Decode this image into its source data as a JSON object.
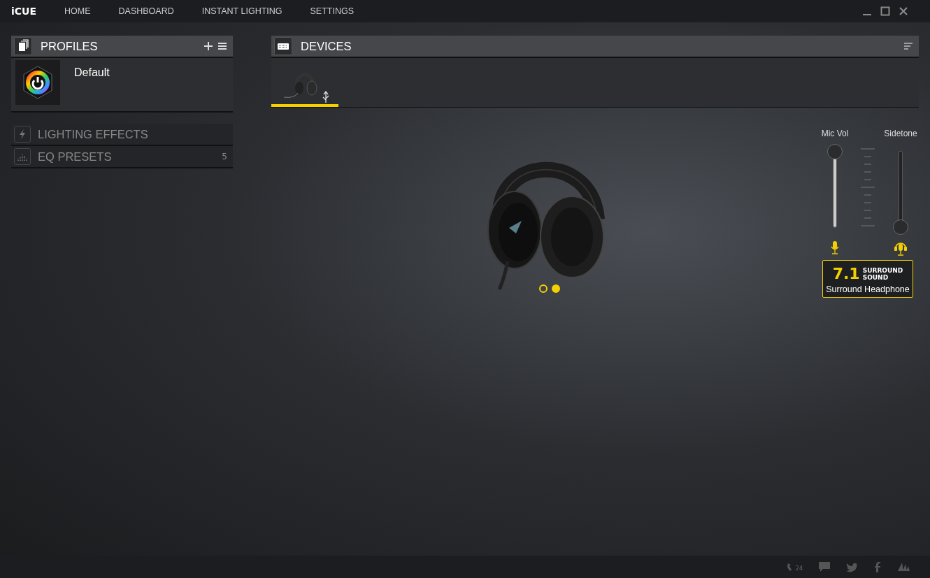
{
  "app": {
    "logo": "iCUE"
  },
  "nav": [
    {
      "label": "HOME",
      "selected": false
    },
    {
      "label": "DASHBOARD",
      "selected": false
    },
    {
      "label": "INSTANT LIGHTING",
      "selected": false
    },
    {
      "label": "SETTINGS",
      "selected": false
    }
  ],
  "profiles": {
    "title": "PROFILES",
    "items": [
      {
        "name": "Default",
        "selected": true
      }
    ]
  },
  "sections": [
    {
      "label": "LIGHTING EFFECTS",
      "kind": "lighting"
    },
    {
      "label": "EQ PRESETS",
      "kind": "eq",
      "count": "5"
    }
  ],
  "devices": {
    "title": "DEVICES",
    "tabs": [
      {
        "selected": true
      }
    ]
  },
  "carousel": [
    {
      "selected": false
    },
    {
      "selected": true
    }
  ],
  "sliders": [
    {
      "label": "Mic Vol",
      "level": 1.0,
      "kind": "mic"
    },
    {
      "label": "Sidetone",
      "level": 0.0,
      "kind": "sidetone"
    }
  ],
  "surround": {
    "number": "7.1",
    "line1": "SURROUND",
    "line2": "SOUND",
    "mode": "Surround Headphone"
  },
  "footer": {
    "support_badge": "24"
  }
}
